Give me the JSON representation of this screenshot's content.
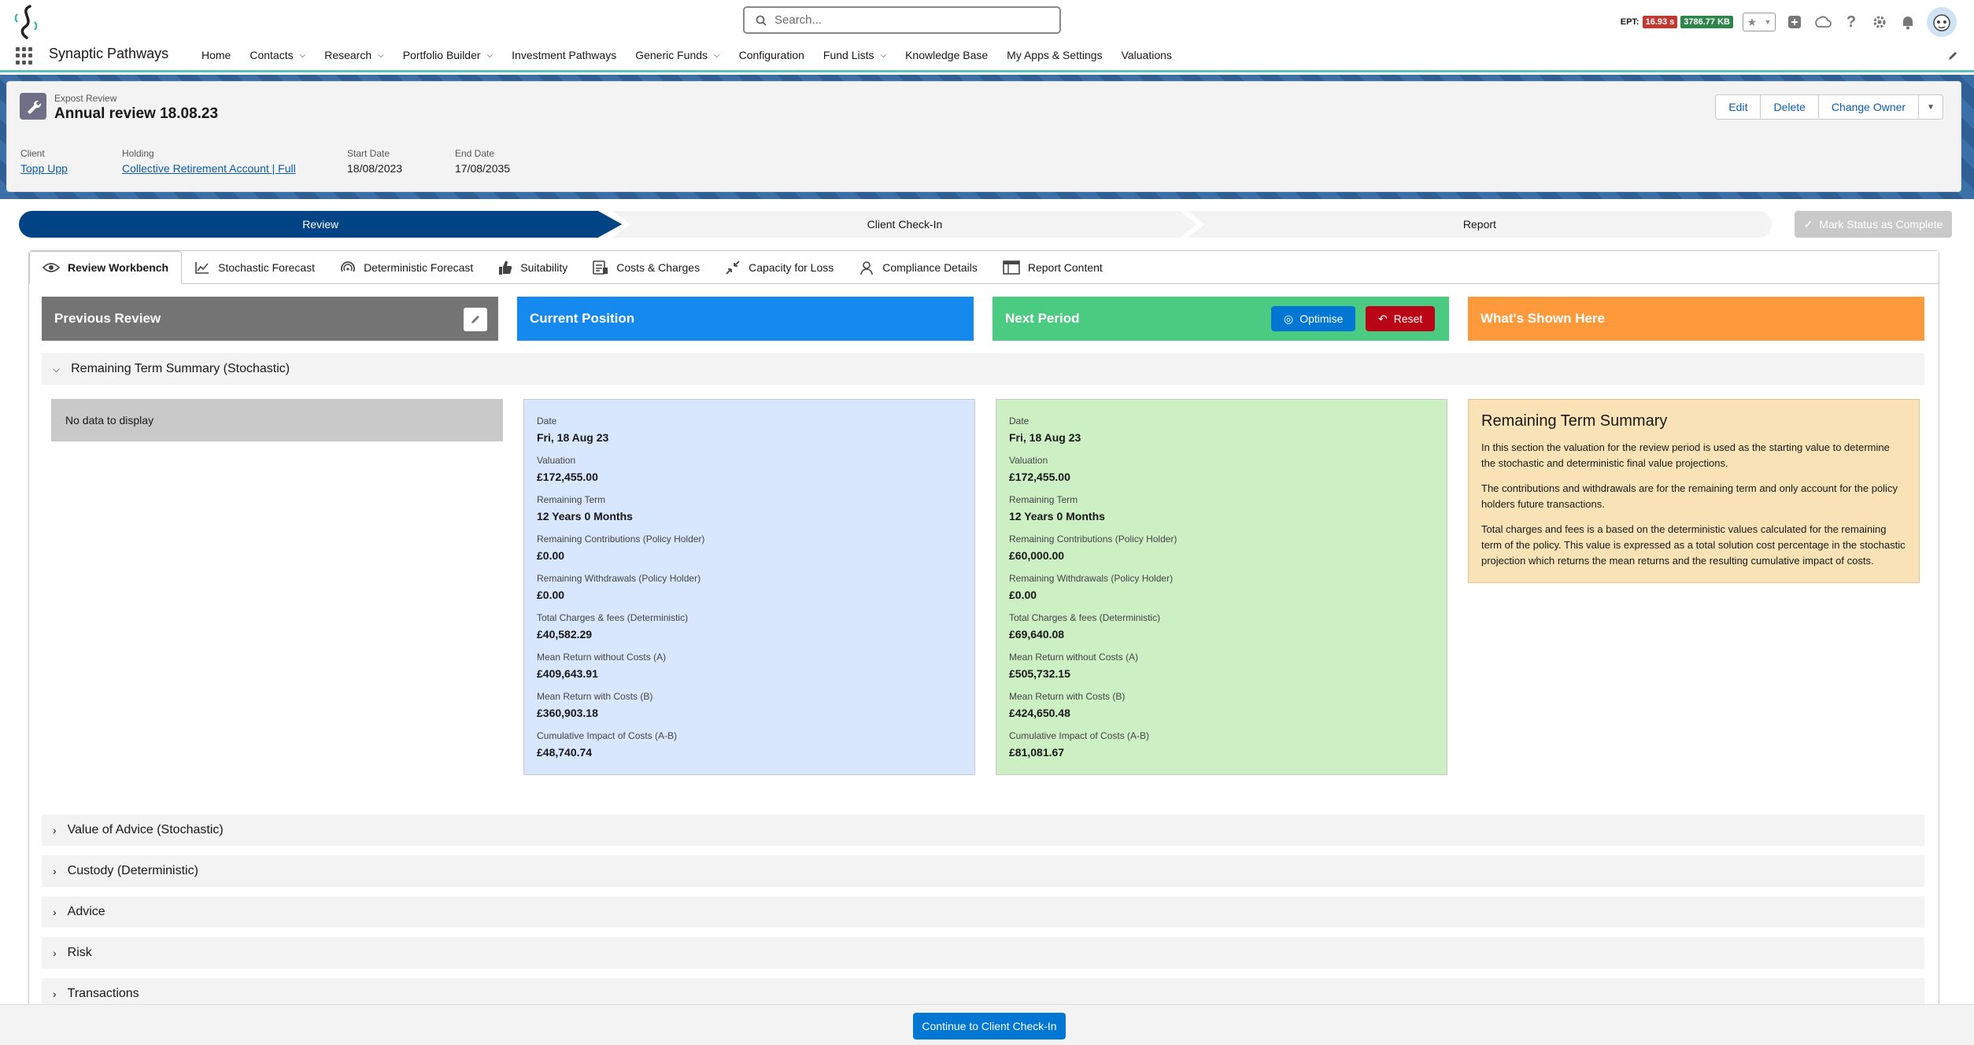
{
  "app": {
    "name": "Synaptic Pathways"
  },
  "search": {
    "placeholder": "Search..."
  },
  "ept": {
    "label": "EPT:",
    "time": "16.93 s",
    "size": "3786.77 KB"
  },
  "nav": {
    "items": [
      "Home",
      "Contacts",
      "Research",
      "Portfolio Builder",
      "Investment Pathways",
      "Generic Funds",
      "Configuration",
      "Fund Lists",
      "Knowledge Base",
      "My Apps & Settings",
      "Valuations"
    ]
  },
  "record": {
    "object_type": "Expost Review",
    "title": "Annual review 18.08.23",
    "actions": {
      "edit": "Edit",
      "delete": "Delete",
      "change_owner": "Change Owner"
    },
    "fields": {
      "client_label": "Client",
      "client_value": "Topp Upp",
      "holding_label": "Holding",
      "holding_value": "Collective Retirement Account | Full",
      "start_label": "Start Date",
      "start_value": "18/08/2023",
      "end_label": "End Date",
      "end_value": "17/08/2035"
    }
  },
  "path": {
    "steps": [
      "Review",
      "Client Check-In",
      "Report"
    ],
    "current": "Review",
    "mark_complete": "Mark Status as Complete"
  },
  "tabs": [
    "Review Workbench",
    "Stochastic Forecast",
    "Deterministic Forecast",
    "Suitability",
    "Costs & Charges",
    "Capacity for Loss",
    "Compliance Details",
    "Report Content"
  ],
  "columns": {
    "previous": "Previous Review",
    "current": "Current Position",
    "next": "Next Period",
    "shown": "What's Shown Here",
    "optimise": "Optimise",
    "reset": "Reset"
  },
  "sections": {
    "remaining": "Remaining Term Summary (Stochastic)",
    "collapsed": [
      "Value of Advice (Stochastic)",
      "Custody (Deterministic)",
      "Advice",
      "Risk",
      "Transactions"
    ]
  },
  "previous": {
    "no_data": "No data to display"
  },
  "current_position": {
    "date_label": "Date",
    "date": "Fri, 18 Aug 23",
    "valuation_label": "Valuation",
    "valuation": "£172,455.00",
    "term_label": "Remaining Term",
    "term": "12 Years 0 Months",
    "contrib_label": "Remaining Contributions (Policy Holder)",
    "contrib": "£0.00",
    "withdraw_label": "Remaining Withdrawals (Policy Holder)",
    "withdraw": "£0.00",
    "charges_label": "Total Charges & fees (Deterministic)",
    "charges": "£40,582.29",
    "mean_a_label": "Mean Return without Costs (A)",
    "mean_a": "£409,643.91",
    "mean_b_label": "Mean Return with Costs (B)",
    "mean_b": "£360,903.18",
    "impact_label": "Cumulative Impact of Costs (A-B)",
    "impact": "£48,740.74"
  },
  "next_period": {
    "date_label": "Date",
    "date": "Fri, 18 Aug 23",
    "valuation_label": "Valuation",
    "valuation": "£172,455.00",
    "term_label": "Remaining Term",
    "term": "12 Years 0 Months",
    "contrib_label": "Remaining Contributions (Policy Holder)",
    "contrib": "£60,000.00",
    "withdraw_label": "Remaining Withdrawals (Policy Holder)",
    "withdraw": "£0.00",
    "charges_label": "Total Charges & fees (Deterministic)",
    "charges": "£69,640.08",
    "mean_a_label": "Mean Return without Costs (A)",
    "mean_a": "£505,732.15",
    "mean_b_label": "Mean Return with Costs (B)",
    "mean_b": "£424,650.48",
    "impact_label": "Cumulative Impact of Costs (A-B)",
    "impact": "£81,081.67"
  },
  "info": {
    "title": "Remaining Term Summary",
    "p1": "In this section the valuation for the review period is used as the starting value to determine the stochastic and deterministic final value projections.",
    "p2": "The contributions and withdrawals are for the remaining term and only account for the policy holders future transactions.",
    "p3": "Total charges and fees is a based on the deterministic values calculated for the remaining term of the policy. This value is expressed as a total solution cost percentage in the stochastic projection which returns the mean returns and the resulting cumulative impact of costs."
  },
  "footer": {
    "continue": "Continue to Client Check-In"
  },
  "colors": {
    "path_active": "#014486",
    "current": "#1589ee",
    "next": "#4bca81",
    "shown": "#ff9a3c",
    "previous": "#747474",
    "brand": "#0176d3"
  }
}
